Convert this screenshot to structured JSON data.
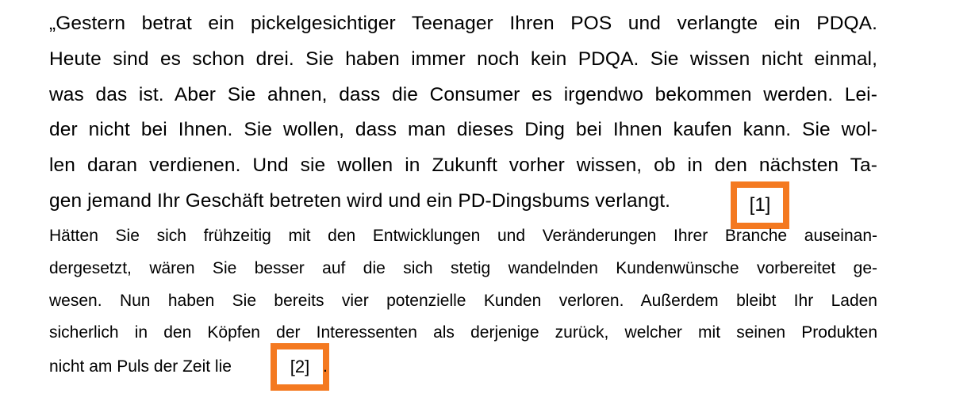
{
  "paragraph_1": {
    "lines": [
      "„Gestern betrat ein pickelgesichtiger Teenager Ihren POS und verlangte ein PDQA.",
      "Heute sind es schon drei. Sie haben immer noch kein PDQA. Sie wissen nicht einmal,",
      "was das ist. Aber Sie ahnen, dass die Consumer es irgendwo bekommen werden. Lei-",
      "der nicht bei Ihnen. Sie wollen, dass man dieses Ding bei Ihnen kaufen kann. Sie wol-",
      "len daran verdienen. Und sie wollen in Zukunft vorher wissen, ob in den nächsten Ta-",
      "gen jemand Ihr Geschäft betreten wird und ein PD-Dingsbums verlangt."
    ],
    "reference": "[1]"
  },
  "paragraph_2": {
    "lines": [
      "Hätten Sie sich frühzeitig mit den Entwicklungen und Veränderungen Ihrer Branche auseinan-",
      "dergesetzt, wären Sie besser auf die sich stetig wandelnden Kundenwünsche vorbereitet ge-",
      "wesen. Nun haben Sie bereits vier potenzielle Kunden verloren. Außerdem bleibt Ihr Laden",
      "sicherlich in den Köpfen der Interessenten als derjenige zurück, welcher mit seinen Produkten",
      "nicht am Puls der Zeit lie"
    ],
    "reference": "[2]",
    "trailing": "."
  },
  "colors": {
    "highlight_border": "#f47920",
    "text": "#000000",
    "background": "#ffffff"
  }
}
